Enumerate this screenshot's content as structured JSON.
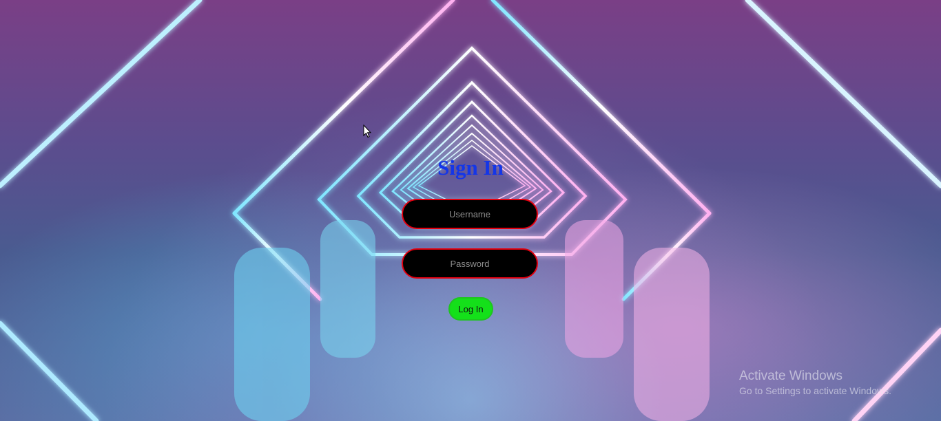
{
  "login": {
    "title": "Sign In",
    "username_placeholder": "Username",
    "password_placeholder": "Password",
    "submit_label": "Log In"
  },
  "watermark": {
    "title": "Activate Windows",
    "subtitle": "Go to Settings to activate Windows."
  },
  "colors": {
    "title": "#1436e8",
    "field_border": "#e3000f",
    "field_bg": "#000000",
    "button_bg": "#14e01a"
  },
  "icons": {
    "cursor": "mouse-pointer-icon"
  }
}
